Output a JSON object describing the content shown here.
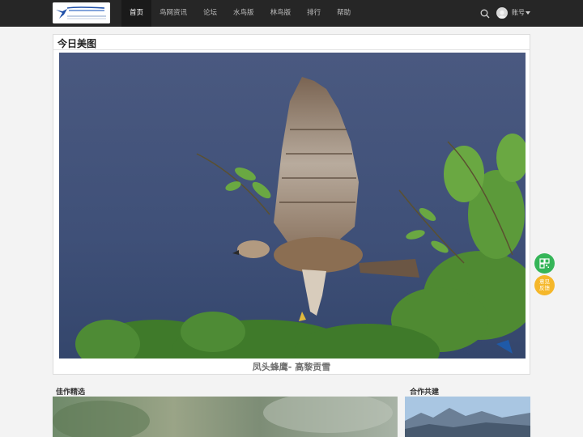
{
  "nav": {
    "items": [
      {
        "label": "首页",
        "active": true
      },
      {
        "label": "鸟网资讯",
        "active": false
      },
      {
        "label": "论坛",
        "active": false
      },
      {
        "label": "水鸟版",
        "active": false
      },
      {
        "label": "林鸟版",
        "active": false
      },
      {
        "label": "排行",
        "active": false
      },
      {
        "label": "帮助",
        "active": false
      }
    ],
    "account_label": "账号",
    "icons": {
      "search": "search-icon",
      "account": "avatar-icon",
      "dropdown": "caret-down-icon"
    }
  },
  "today_photo": {
    "section_title": "今日美图",
    "caption": "凤头蜂鹰- 高黎贡雪"
  },
  "floating": {
    "qr_icon": "qr-code-icon",
    "feedback_label": "意见反馈"
  },
  "sections": {
    "featured_title": "佳作精选",
    "partner_title": "合作共建"
  },
  "colors": {
    "nav_bg": "#262626",
    "qr_button": "#35b558",
    "feedback_button": "#f5b72a",
    "caption_text": "#6e6e6e"
  }
}
